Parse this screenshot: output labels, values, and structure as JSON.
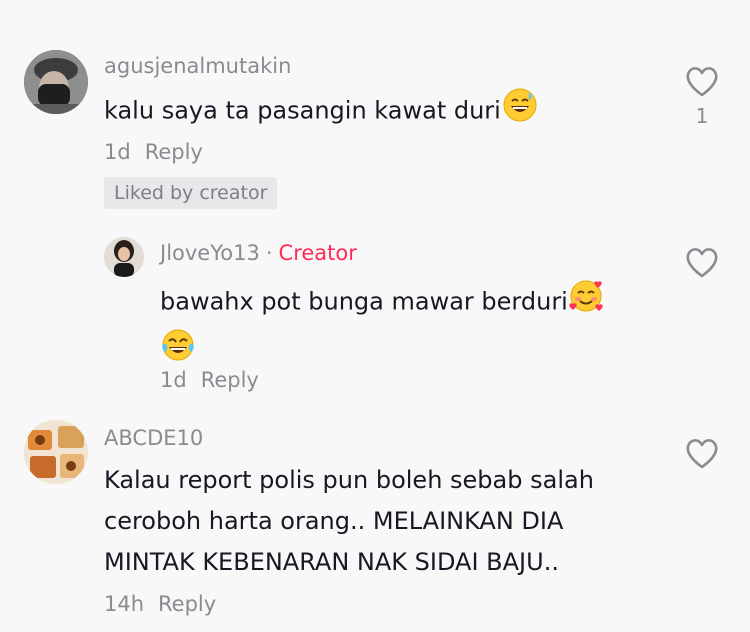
{
  "comments": [
    {
      "username": "agusjenalmutakin",
      "text": "kalu saya ta pasangin kawat duri",
      "emoji": "sweat-smile-emoji",
      "time": "1d",
      "reply_label": "Reply",
      "liked_badge": "Liked by creator",
      "like_count": "1",
      "replies": [
        {
          "username": "JloveYo13",
          "creator_dot": "·",
          "creator_label": "Creator",
          "text": "bawahx pot bunga mawar berduri",
          "emoji_1": "smiling-hearts-emoji",
          "emoji_2": "tears-of-joy-emoji",
          "time": "1d",
          "reply_label": "Reply"
        }
      ]
    },
    {
      "username": "ABCDE10",
      "text_lines": [
        "Kalau report polis pun boleh sebab salah",
        "ceroboh harta orang.. MELAINKAN DIA",
        "MINTAK KEBENARAN NAK SIDAI BAJU.."
      ],
      "time": "14h",
      "reply_label": "Reply"
    }
  ],
  "colors": {
    "background": "#f8f8f8",
    "text": "#161823",
    "secondary": "#8a8b91",
    "creator": "#fe2c55",
    "badge_bg": "#e8e8ea"
  }
}
